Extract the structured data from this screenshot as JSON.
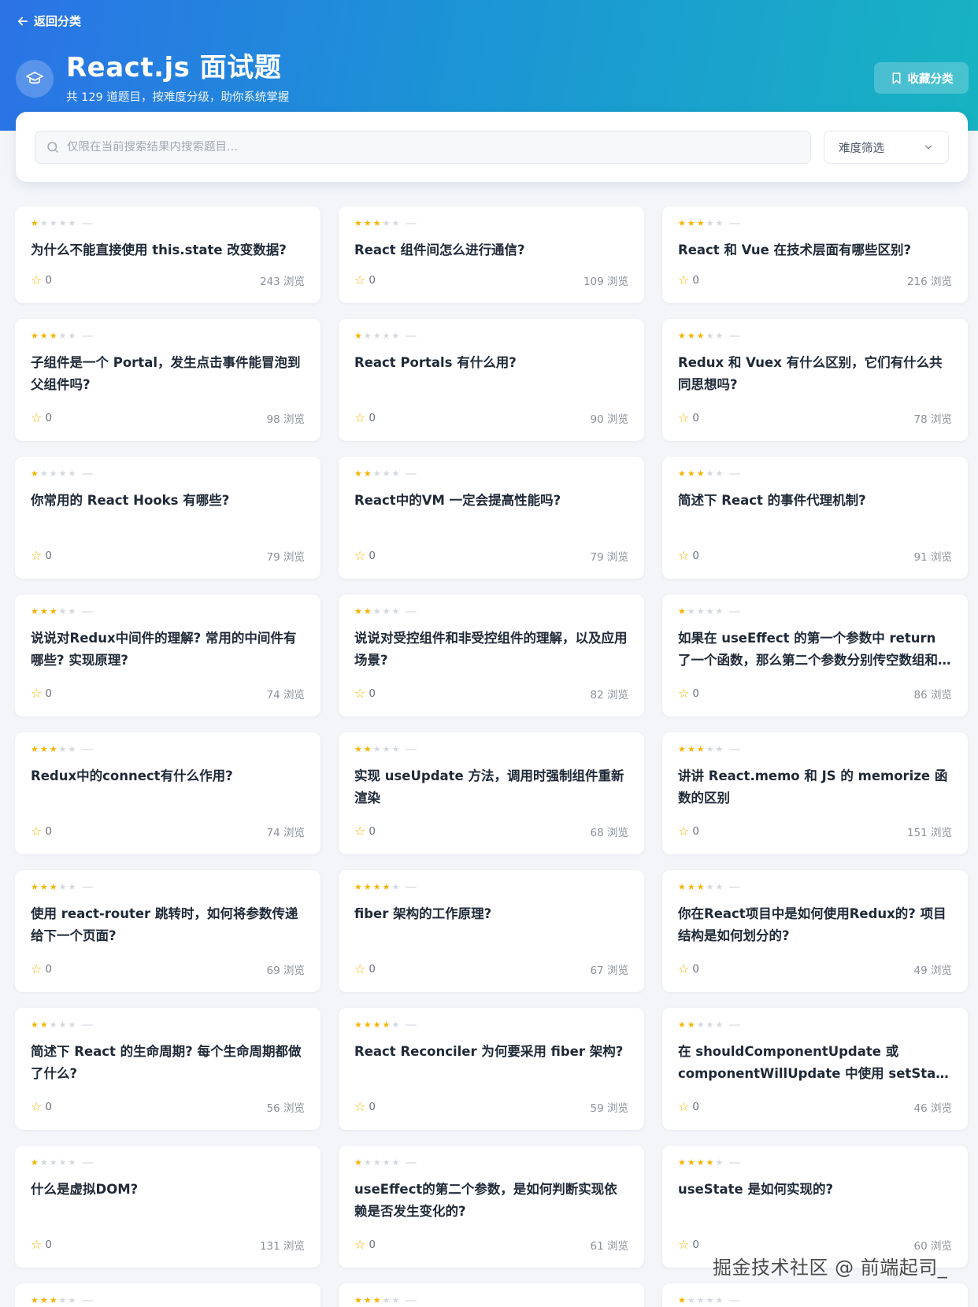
{
  "header": {
    "back_label": "返回分类",
    "title": "React.js 面试题",
    "subtitle": "共 129 道题目，按难度分级，助你系统掌握",
    "favorite_label": "收藏分类"
  },
  "search": {
    "placeholder": "仅限在当前搜索结果内搜索题目...",
    "difficulty_label": "难度筛选"
  },
  "views_suffix": "浏览",
  "questions": [
    {
      "title": "为什么不能直接使用 this.state 改变数据?",
      "stars": 1,
      "likes": "0",
      "views": "243 浏览"
    },
    {
      "title": "React 组件间怎么进行通信?",
      "stars": 3,
      "likes": "0",
      "views": "109 浏览"
    },
    {
      "title": "React 和 Vue 在技术层面有哪些区别?",
      "stars": 3,
      "likes": "0",
      "views": "216 浏览"
    },
    {
      "title": "子组件是一个 Portal，发生点击事件能冒泡到父组件吗?",
      "stars": 3,
      "likes": "0",
      "views": "98 浏览"
    },
    {
      "title": "React Portals 有什么用?",
      "stars": 1,
      "likes": "0",
      "views": "90 浏览"
    },
    {
      "title": "Redux 和 Vuex 有什么区别，它们有什么共同思想吗?",
      "stars": 3,
      "likes": "0",
      "views": "78 浏览"
    },
    {
      "title": "你常用的 React Hooks 有哪些?",
      "stars": 1,
      "likes": "0",
      "views": "79 浏览"
    },
    {
      "title": "React中的VM 一定会提高性能吗?",
      "stars": 2,
      "likes": "0",
      "views": "79 浏览"
    },
    {
      "title": "简述下 React 的事件代理机制?",
      "stars": 3,
      "likes": "0",
      "views": "91 浏览"
    },
    {
      "title": "说说对Redux中间件的理解? 常用的中间件有哪些? 实现原理?",
      "stars": 3,
      "likes": "0",
      "views": "74 浏览"
    },
    {
      "title": "说说对受控组件和非受控组件的理解，以及应用场景?",
      "stars": 2,
      "likes": "0",
      "views": "82 浏览"
    },
    {
      "title": "如果在 useEffect 的第一个参数中 return 了一个函数，那么第二个参数分别传空数组和不传时，二者有什么区别?",
      "stars": 1,
      "likes": "0",
      "views": "86 浏览"
    },
    {
      "title": "Redux中的connect有什么作用?",
      "stars": 3,
      "likes": "0",
      "views": "74 浏览"
    },
    {
      "title": "实现 useUpdate 方法，调用时强制组件重新渲染",
      "stars": 2,
      "likes": "0",
      "views": "68 浏览"
    },
    {
      "title": "讲讲 React.memo 和 JS 的 memorize 函数的区别",
      "stars": 3,
      "likes": "0",
      "views": "151 浏览"
    },
    {
      "title": "使用 react-router 跳转时，如何将参数传递给下一个页面?",
      "stars": 3,
      "likes": "0",
      "views": "69 浏览"
    },
    {
      "title": "fiber 架构的工作原理?",
      "stars": 4,
      "likes": "0",
      "views": "67 浏览"
    },
    {
      "title": "你在React项目中是如何使用Redux的? 项目结构是如何划分的?",
      "stars": 3,
      "likes": "0",
      "views": "49 浏览"
    },
    {
      "title": "简述下 React 的生命周期? 每个生命周期都做了什么?",
      "stars": 2,
      "likes": "0",
      "views": "56 浏览"
    },
    {
      "title": "React Reconciler 为何要采用 fiber 架构?",
      "stars": 4,
      "likes": "0",
      "views": "59 浏览"
    },
    {
      "title": "在 shouldComponentUpdate 或 componentWillUpdate 中使用 setState 会发生什么?",
      "stars": 2,
      "likes": "0",
      "views": "46 浏览"
    },
    {
      "title": "什么是虚拟DOM?",
      "stars": 1,
      "likes": "0",
      "views": "131 浏览"
    },
    {
      "title": "useEffect的第二个参数，是如何判断实现依赖是否发生变化的?",
      "stars": 1,
      "likes": "0",
      "views": "61 浏览"
    },
    {
      "title": "useState 是如何实现的?",
      "stars": 4,
      "likes": "0",
      "views": "60 浏览"
    },
    {
      "title": "",
      "stars": 3,
      "likes": "",
      "views": ""
    },
    {
      "title": "",
      "stars": 3,
      "likes": "",
      "views": ""
    },
    {
      "title": "",
      "stars": 1,
      "likes": "",
      "views": ""
    }
  ],
  "watermark": "掘金技术社区 @ 前端起司_",
  "colors": {
    "accent_start": "#2b73e6",
    "accent_end": "#17b3c2",
    "star": "#f5b301"
  }
}
